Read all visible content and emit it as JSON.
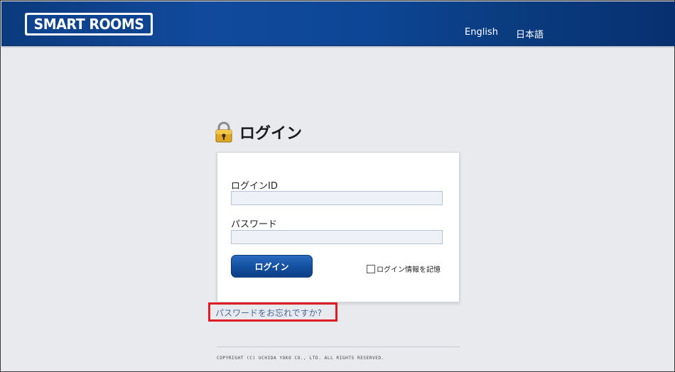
{
  "header": {
    "logo_text": "SMART ROOMS",
    "languages": [
      {
        "label": "English"
      },
      {
        "label": "日本語"
      }
    ]
  },
  "page": {
    "title": "ログイン",
    "icon": "lock-icon"
  },
  "form": {
    "id_label": "ログインID",
    "id_value": "",
    "password_label": "パスワード",
    "password_value": "",
    "login_button_label": "ログイン",
    "remember_label": "ログイン情報を記憶",
    "remember_checked": false
  },
  "forgot_password_link": "パスワードをお忘れですか?",
  "footer": {
    "copyright": "COPYRIGHT (C) UCHIDA YOKO CO., LTD. ALL RIGHTS RESERVED."
  },
  "colors": {
    "header": "#0d4695",
    "button": "#134f9e",
    "highlight": "#e01b24",
    "background": "#e9eaee"
  }
}
